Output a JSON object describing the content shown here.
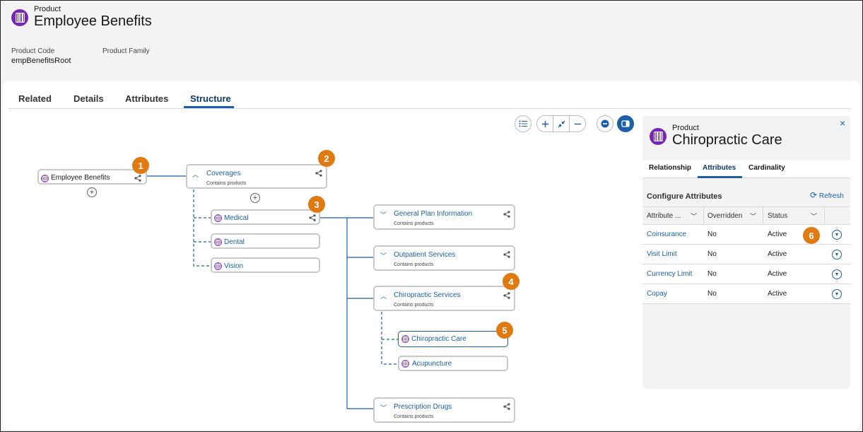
{
  "header": {
    "kicker": "Product",
    "title": "Employee Benefits",
    "fields": [
      {
        "label": "Product Code",
        "value": "empBenefitsRoot"
      },
      {
        "label": "Product Family",
        "value": ""
      }
    ]
  },
  "tabs": [
    {
      "label": "Related"
    },
    {
      "label": "Details"
    },
    {
      "label": "Attributes"
    },
    {
      "label": "Structure",
      "active": true
    }
  ],
  "nodes": {
    "root": {
      "label": "Employee Benefits"
    },
    "coverages": {
      "label": "Coverages",
      "sub": "Contains products"
    },
    "medical": {
      "label": "Medical"
    },
    "dental": {
      "label": "Dental"
    },
    "vision": {
      "label": "Vision"
    },
    "general": {
      "label": "General Plan Information",
      "sub": "Contains products"
    },
    "outpatient": {
      "label": "Outpatient Services",
      "sub": "Contains products"
    },
    "chiro_services": {
      "label": "Chiropractic Services",
      "sub": "Contains products"
    },
    "chiro_care": {
      "label": "Chiropractic Care"
    },
    "acupuncture": {
      "label": "Acupuncture"
    },
    "prescription": {
      "label": "Prescription Drugs",
      "sub": "Contains products"
    }
  },
  "callouts": [
    "1",
    "2",
    "3",
    "4",
    "5",
    "6"
  ],
  "panel": {
    "kicker": "Product",
    "title": "Chiropractic Care",
    "close": "×",
    "tabs": [
      {
        "label": "Relationship"
      },
      {
        "label": "Attributes",
        "active": true
      },
      {
        "label": "Cardinality"
      }
    ],
    "section_title": "Configure Attributes",
    "refresh_label": "Refresh",
    "columns": [
      "Attribute ...",
      "Overridden",
      "Status"
    ],
    "rows": [
      {
        "name": "Coinsurance",
        "overridden": "No",
        "status": "Active"
      },
      {
        "name": "Visit Limit",
        "overridden": "No",
        "status": "Active"
      },
      {
        "name": "Currency Limit",
        "overridden": "No",
        "status": "Active"
      },
      {
        "name": "Copay",
        "overridden": "No",
        "status": "Active"
      }
    ]
  },
  "colors": {
    "brand_purple": "#7526b6",
    "link_blue": "#1b5fa5",
    "callout_orange": "#e07a10"
  }
}
